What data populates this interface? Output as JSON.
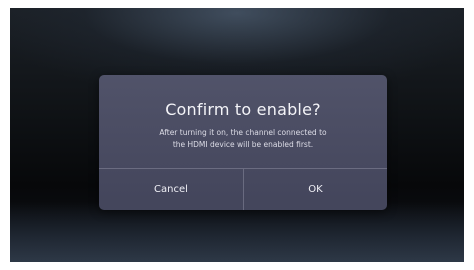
{
  "dialog": {
    "title": "Confirm to enable?",
    "message_lines": [
      "After turning it on, the channel connected to",
      "the HDMI device will be enabled first."
    ],
    "buttons": {
      "cancel_label": "Cancel",
      "ok_label": "OK"
    }
  }
}
